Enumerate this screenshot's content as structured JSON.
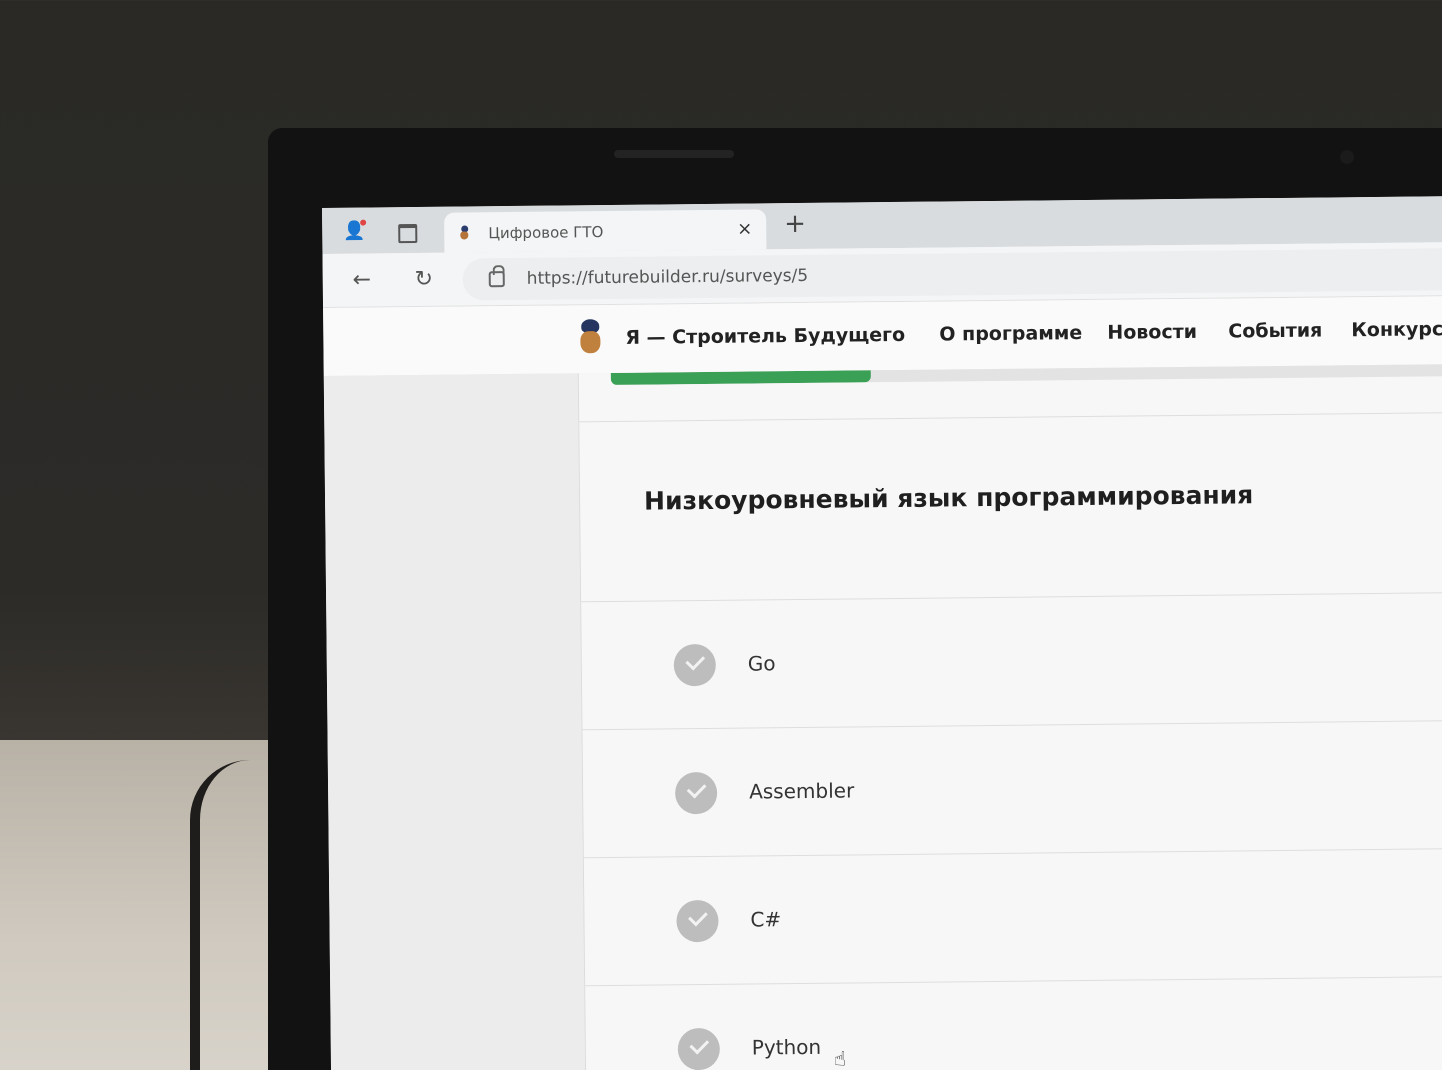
{
  "browser": {
    "tab_title": "Цифровое ГТО",
    "tab_close": "×",
    "new_tab": "+",
    "url": "https://futurebuilder.ru/surveys/5",
    "back_icon": "←",
    "reload_icon": "↻"
  },
  "site": {
    "name": "Я — Строитель Будущего",
    "nav": [
      "О программе",
      "Новости",
      "События",
      "Конкурс"
    ]
  },
  "survey": {
    "progress_percent": 31,
    "question": "Низкоуровневый язык программирования",
    "options": [
      "Go",
      "Assembler",
      "C#",
      "Python"
    ]
  },
  "colors": {
    "progress": "#3aa055",
    "check": "#bdbdbd"
  }
}
